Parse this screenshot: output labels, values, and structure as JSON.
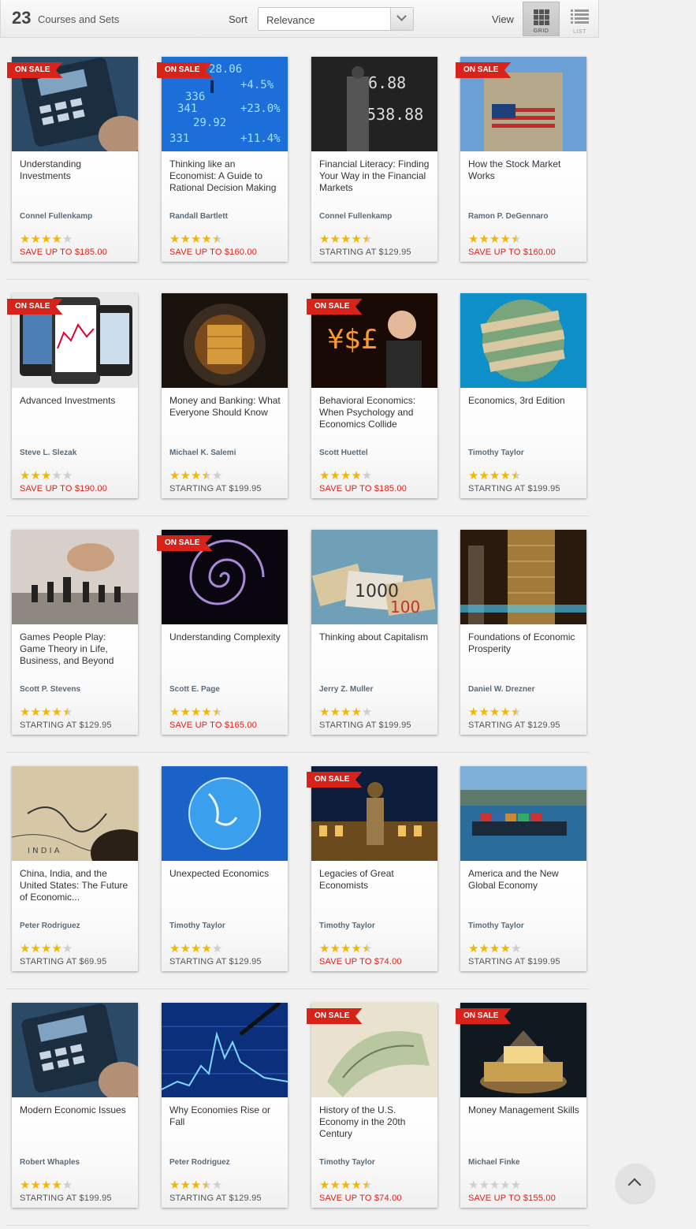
{
  "toolbar": {
    "count": "23",
    "count_label": "Courses and Sets",
    "sort_label": "Sort",
    "sort_value": "Relevance",
    "view_label": "View",
    "grid_label": "GRID",
    "list_label": "LIST",
    "active_view": "grid"
  },
  "badge_text": "ON SALE",
  "colors": {
    "sale": "#d8231a",
    "star": "#f2b705",
    "author": "#5a6a78"
  },
  "courses": [
    {
      "title": "Understanding Investments",
      "author": "Connel Fullenkamp",
      "rating": 4,
      "price": "SAVE UP TO $185.00",
      "sale": true
    },
    {
      "title": "Thinking like an Economist: A Guide to Rational Decision Making",
      "author": "Randall Bartlett",
      "rating": 4.5,
      "price": "SAVE UP TO $160.00",
      "sale": true
    },
    {
      "title": "Financial Literacy: Finding Your Way in the Financial Markets",
      "author": "Connel Fullenkamp",
      "rating": 4.5,
      "price": "STARTING AT $129.95",
      "sale": false
    },
    {
      "title": "How the Stock Market Works",
      "author": "Ramon P. DeGennaro",
      "rating": 4.5,
      "price": "SAVE UP TO $160.00",
      "sale": true
    },
    {
      "title": "Advanced Investments",
      "author": "Steve L. Slezak",
      "rating": 3,
      "price": "SAVE UP TO $190.00",
      "sale": true
    },
    {
      "title": "Money and Banking: What Everyone Should Know",
      "author": "Michael K. Salemi",
      "rating": 3.5,
      "price": "STARTING AT $199.95",
      "sale": false
    },
    {
      "title": "Behavioral Economics: When Psychology and Economics Collide",
      "author": "Scott Huettel",
      "rating": 4,
      "price": "SAVE UP TO $185.00",
      "sale": true
    },
    {
      "title": "Economics, 3rd Edition",
      "author": "Timothy Taylor",
      "rating": 4.5,
      "price": "STARTING AT $199.95",
      "sale": false
    },
    {
      "title": "Games People Play: Game Theory in Life, Business, and Beyond",
      "author": "Scott P. Stevens",
      "rating": 4.5,
      "price": "STARTING AT $129.95",
      "sale": false
    },
    {
      "title": "Understanding Complexity",
      "author": "Scott E. Page",
      "rating": 4.5,
      "price": "SAVE UP TO $165.00",
      "sale": true
    },
    {
      "title": "Thinking about Capitalism",
      "author": "Jerry Z. Muller",
      "rating": 4,
      "price": "STARTING AT $199.95",
      "sale": false
    },
    {
      "title": "Foundations of Economic Prosperity",
      "author": "Daniel W. Drezner",
      "rating": 4.5,
      "price": "STARTING AT $129.95",
      "sale": false
    },
    {
      "title": "China, India, and the United States: The Future of Economic...",
      "author": "Peter Rodriguez",
      "rating": 4,
      "price": "STARTING AT $69.95",
      "sale": false
    },
    {
      "title": "Unexpected Economics",
      "author": "Timothy Taylor",
      "rating": 4,
      "price": "STARTING AT $129.95",
      "sale": false
    },
    {
      "title": "Legacies of Great Economists",
      "author": "Timothy Taylor",
      "rating": 4.5,
      "price": "SAVE UP TO $74.00",
      "sale": true
    },
    {
      "title": "America and the New Global Economy",
      "author": "Timothy Taylor",
      "rating": 4,
      "price": "STARTING AT $199.95",
      "sale": false
    },
    {
      "title": "Modern Economic Issues",
      "author": "Robert Whaples",
      "rating": 4,
      "price": "STARTING AT $199.95",
      "sale": false
    },
    {
      "title": "Why Economies Rise or Fall",
      "author": "Peter Rodriguez",
      "rating": 3.5,
      "price": "STARTING AT $129.95",
      "sale": false
    },
    {
      "title": "History of the U.S. Economy in the 20th Century",
      "author": "Timothy Taylor",
      "rating": 4.5,
      "price": "SAVE UP TO $74.00",
      "sale": true
    },
    {
      "title": "Money Management Skills",
      "author": "Michael Finke",
      "rating": 0,
      "price": "SAVE UP TO $155.00",
      "sale": true
    }
  ]
}
